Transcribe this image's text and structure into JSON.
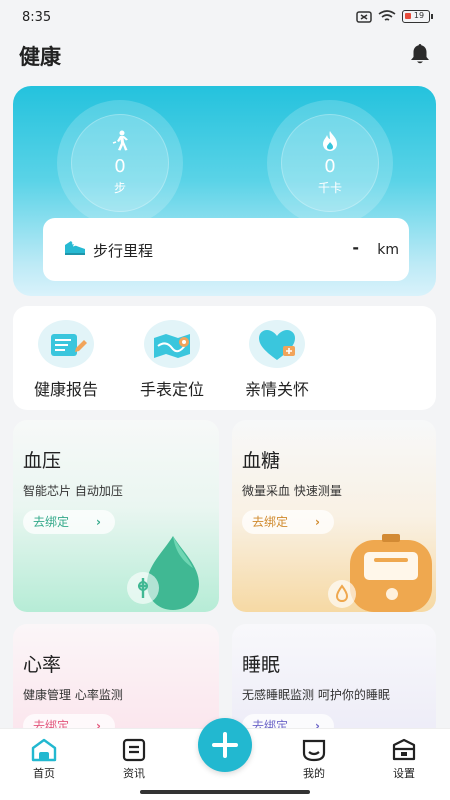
{
  "status": {
    "time": "8:35",
    "battery": "19"
  },
  "header": {
    "title": "健康"
  },
  "hero": {
    "steps": {
      "value": "0",
      "unit": "步"
    },
    "calories": {
      "value": "0",
      "unit": "千卡"
    },
    "distance": {
      "label": "步行里程",
      "value": "-",
      "unit": "km"
    }
  },
  "quick": [
    {
      "label": "健康报告",
      "icon": "report-icon"
    },
    {
      "label": "手表定位",
      "icon": "map-location-icon"
    },
    {
      "label": "亲情关怀",
      "icon": "heart-care-icon"
    }
  ],
  "cards": {
    "bp": {
      "title": "血压",
      "subtitle": "智能芯片  自动加压",
      "bind": "去绑定"
    },
    "bs": {
      "title": "血糖",
      "subtitle": "微量采血  快速测量",
      "bind": "去绑定"
    },
    "hr": {
      "title": "心率",
      "subtitle": "健康管理  心率监测",
      "bind": "去绑定"
    },
    "sl": {
      "title": "睡眠",
      "subtitle": "无感睡眠监测  呵护你的睡眠",
      "bind": "去绑定"
    }
  },
  "tabs": [
    {
      "label": "首页",
      "icon": "home-icon"
    },
    {
      "label": "资讯",
      "icon": "news-icon"
    },
    {
      "label": "我的",
      "icon": "profile-icon"
    },
    {
      "label": "设置",
      "icon": "settings-icon"
    }
  ],
  "colors": {
    "accent": "#22b8d0",
    "bp": "#34a98a",
    "bs": "#d08a2d",
    "hr": "#e2567c",
    "sleep": "#6b64c7"
  }
}
